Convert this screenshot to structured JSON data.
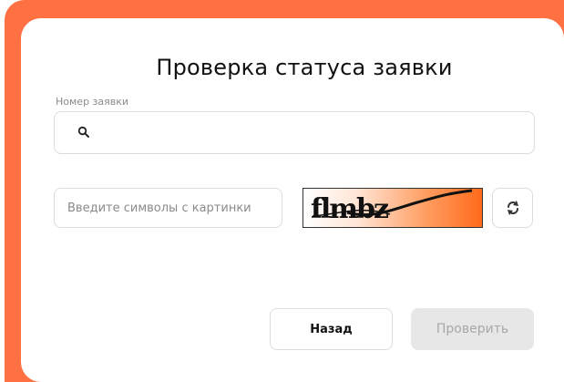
{
  "form": {
    "title": "Проверка статуса заявки",
    "application_number_label": "Номер заявки",
    "application_number_value": "",
    "captcha_placeholder": "Введите символы с картинки",
    "captcha_image_text": "flmbz",
    "back_label": "Назад",
    "check_label": "Проверить"
  },
  "icons": {
    "search": "search-icon",
    "refresh": "refresh-icon"
  },
  "colors": {
    "accent": "#ff7043",
    "disabled_button_bg": "#e7e7e7",
    "disabled_button_text": "#a8a8a8"
  }
}
